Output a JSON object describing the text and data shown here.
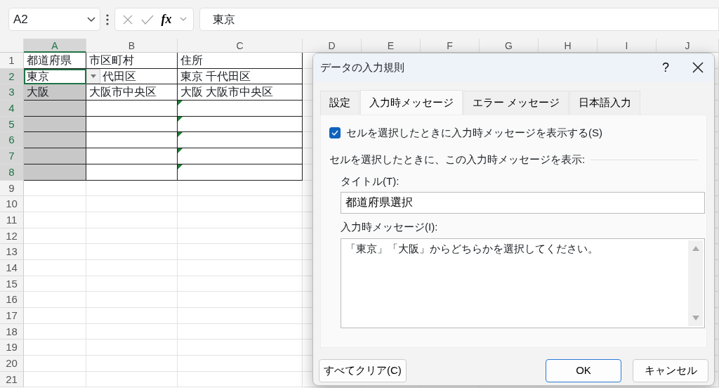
{
  "name_box": {
    "value": "A2"
  },
  "formula_bar": {
    "function_button": "fx",
    "value": "東京"
  },
  "columns": [
    {
      "label": "A",
      "selected": true
    },
    {
      "label": "B",
      "selected": false
    },
    {
      "label": "C",
      "selected": false
    },
    {
      "label": "D",
      "selected": false
    },
    {
      "label": "E",
      "selected": false
    },
    {
      "label": "F",
      "selected": false
    },
    {
      "label": "G",
      "selected": false
    },
    {
      "label": "H",
      "selected": false
    },
    {
      "label": "I",
      "selected": false
    },
    {
      "label": "J",
      "selected": false
    }
  ],
  "rows": [
    {
      "label": "1",
      "selected": false,
      "cells": [
        {
          "text": "都道府県",
          "selected": false
        },
        {
          "text": "市区町村",
          "selected": false
        },
        {
          "text": "住所",
          "selected": false
        }
      ]
    },
    {
      "label": "2",
      "selected": true,
      "cells": [
        {
          "text": "東京",
          "selected": false,
          "active": true
        },
        {
          "text": "代田区",
          "selected": false,
          "dropdown": true
        },
        {
          "text": "東京 千代田区",
          "selected": false
        }
      ]
    },
    {
      "label": "3",
      "selected": true,
      "cells": [
        {
          "text": "大阪",
          "selected": true
        },
        {
          "text": "大阪市中央区",
          "selected": false
        },
        {
          "text": "大阪 大阪市中央区",
          "selected": false
        }
      ]
    },
    {
      "label": "4",
      "selected": true,
      "cells": [
        {
          "selected": true
        },
        {
          "selected": false
        },
        {
          "selected": false,
          "error_flag": true
        }
      ]
    },
    {
      "label": "5",
      "selected": true,
      "cells": [
        {
          "selected": true
        },
        {
          "selected": false
        },
        {
          "selected": false,
          "error_flag": true
        }
      ]
    },
    {
      "label": "6",
      "selected": true,
      "cells": [
        {
          "selected": true
        },
        {
          "selected": false
        },
        {
          "selected": false,
          "error_flag": true
        }
      ]
    },
    {
      "label": "7",
      "selected": true,
      "cells": [
        {
          "selected": true
        },
        {
          "selected": false
        },
        {
          "selected": false,
          "error_flag": true
        }
      ]
    },
    {
      "label": "8",
      "selected": true,
      "cells": [
        {
          "selected": true
        },
        {
          "selected": false
        },
        {
          "selected": false,
          "error_flag": true
        }
      ]
    },
    {
      "label": "9",
      "selected": false
    },
    {
      "label": "10",
      "selected": false
    },
    {
      "label": "11",
      "selected": false
    },
    {
      "label": "12",
      "selected": false
    },
    {
      "label": "13",
      "selected": false
    },
    {
      "label": "14",
      "selected": false
    },
    {
      "label": "15",
      "selected": false
    },
    {
      "label": "16",
      "selected": false
    },
    {
      "label": "17",
      "selected": false
    },
    {
      "label": "18",
      "selected": false
    },
    {
      "label": "19",
      "selected": false
    },
    {
      "label": "20",
      "selected": false
    },
    {
      "label": "21",
      "selected": false
    }
  ],
  "dialog": {
    "title": "データの入力規則",
    "help": "?",
    "tabs": [
      {
        "label": "設定",
        "selected": false
      },
      {
        "label": "入力時メッセージ",
        "selected": true
      },
      {
        "label": "エラー メッセージ",
        "selected": false
      },
      {
        "label": "日本語入力",
        "selected": false
      }
    ],
    "show_message": {
      "label": "セルを選択したときに入力時メッセージを表示する(S)",
      "checked": true
    },
    "section_label": "セルを選択したときに、この入力時メッセージを表示:",
    "title_field": {
      "label": "タイトル(T):",
      "value": "都道府県選択"
    },
    "message_field": {
      "label": "入力時メッセージ(I):",
      "value": "「東京」「大阪」からどちらかを選択してください。"
    },
    "buttons": [
      {
        "label": "すべてクリア(C)",
        "kind": "secondary"
      },
      {
        "label": "OK",
        "kind": "default"
      },
      {
        "label": "キャンセル",
        "kind": "secondary"
      }
    ]
  }
}
